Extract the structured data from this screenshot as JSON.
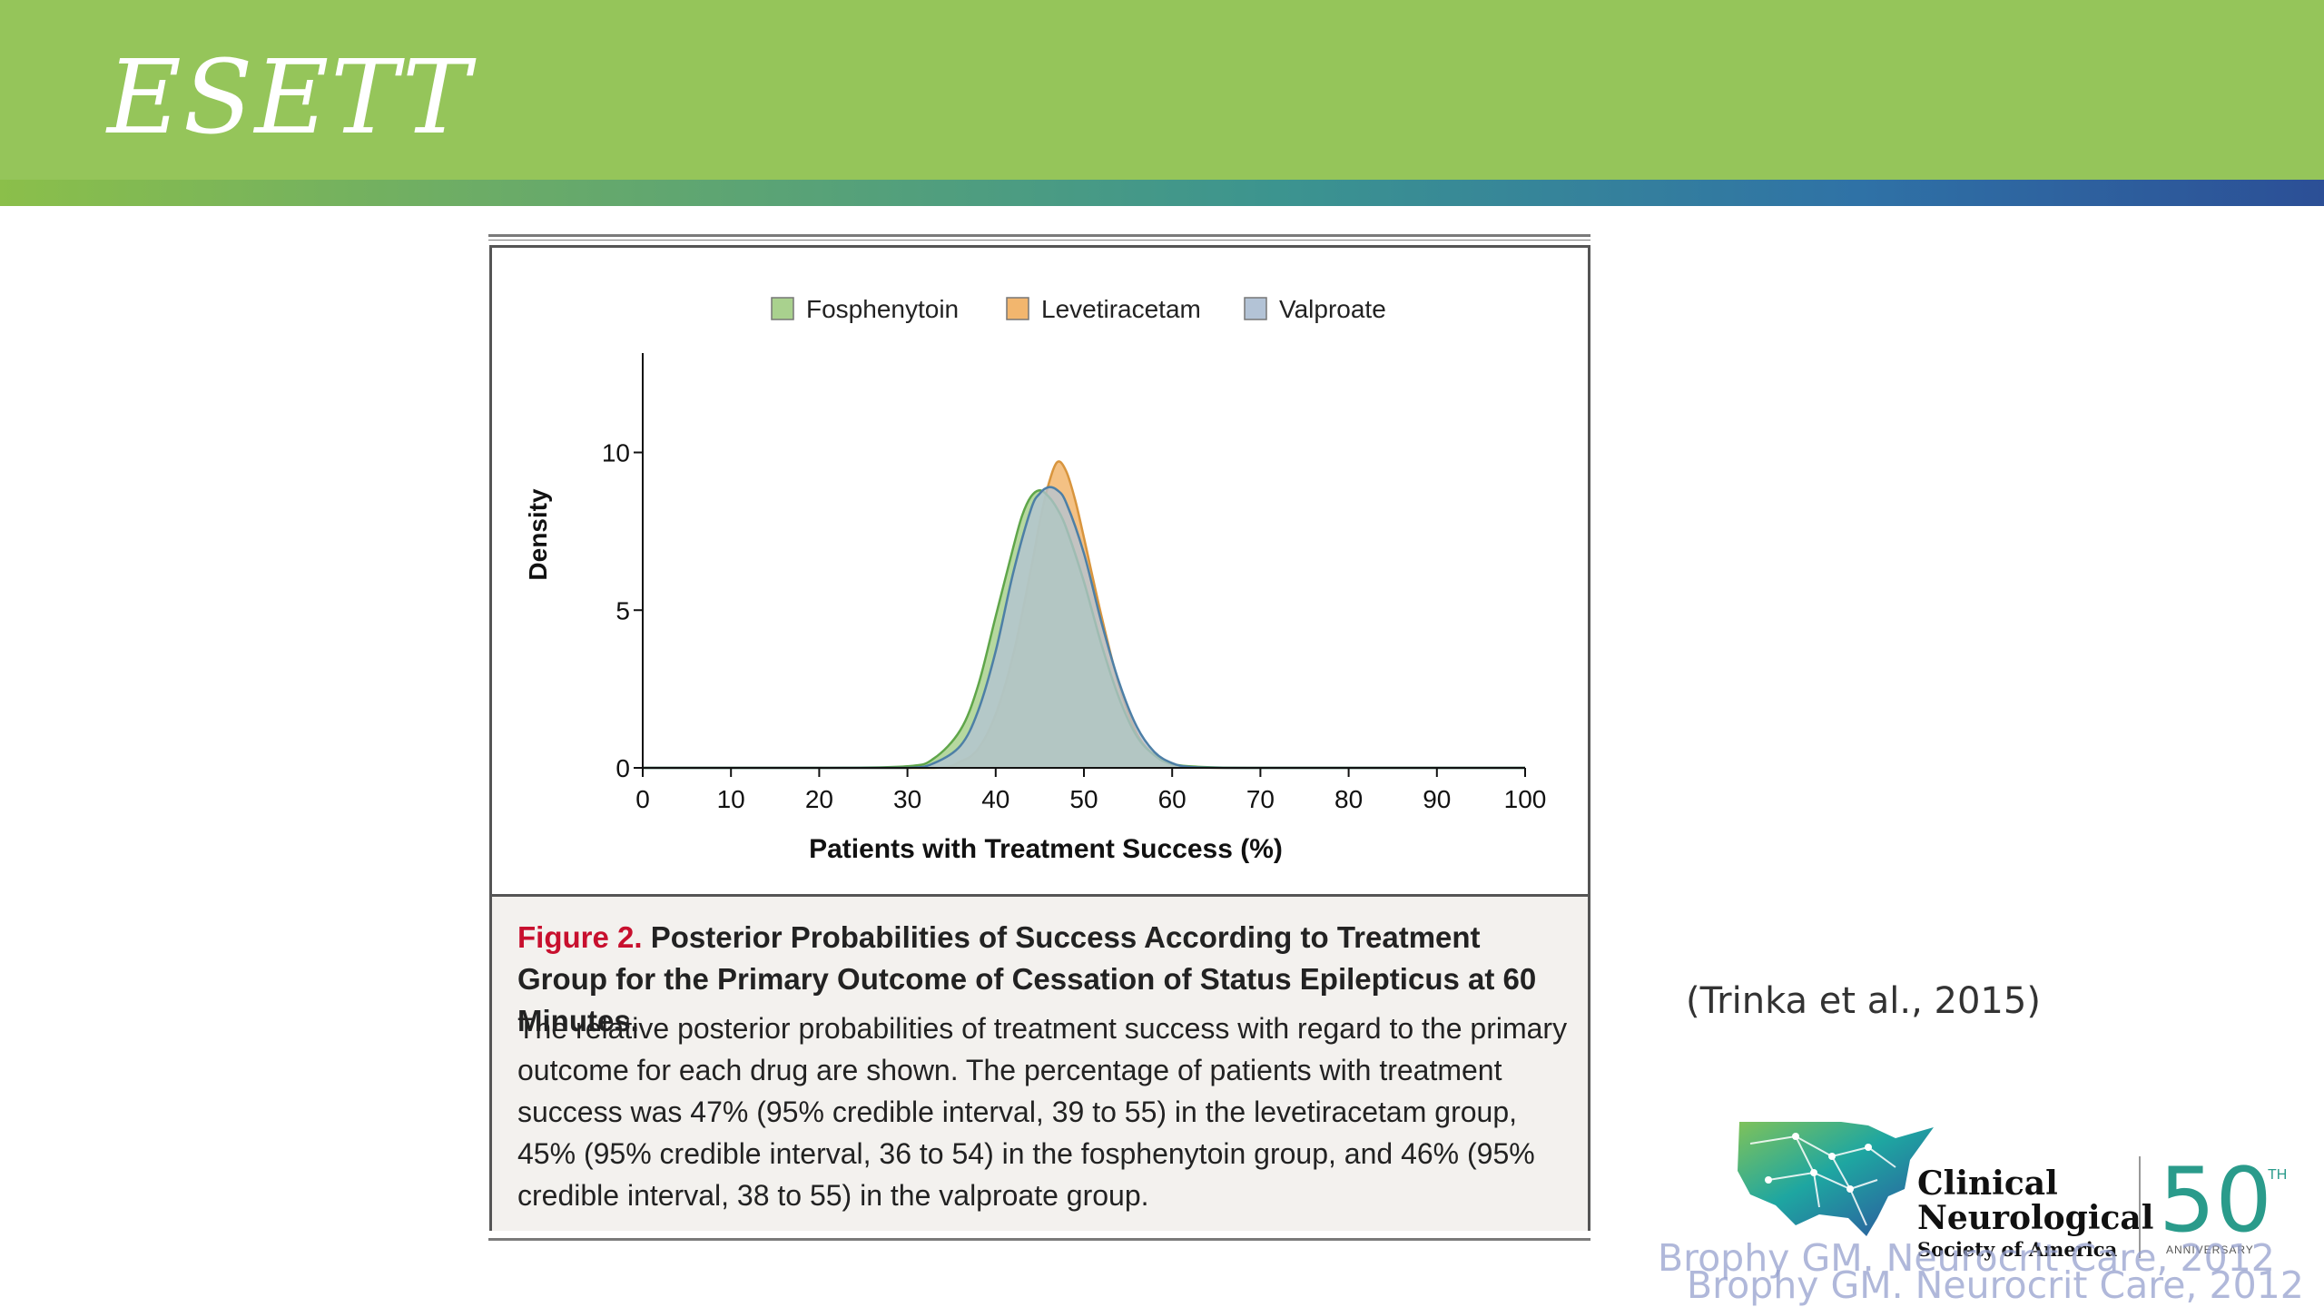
{
  "header": {
    "logo_text": "ESETT",
    "banner_color": "#95c55a"
  },
  "figure": {
    "label": "Figure 2.",
    "title": "Posterior Probabilities of Success According to Treatment Group for the Primary Outcome of Cessation of Status Epilepticus at 60 Minutes.",
    "body": "The relative posterior probabilities of treatment success with regard to the primary outcome for each drug are shown. The percentage of patients with treatment success was 47% (95% credible interval, 39 to 55) in the levetiracetam group, 45% (95% credible interval, 36 to 54) in the fosphenytoin group, and 46% (95% credible interval, 38 to 55) in the valproate group."
  },
  "chart_data": {
    "type": "area",
    "title": "",
    "xlabel": "Patients with Treatment Success (%)",
    "ylabel": "Density",
    "xlim": [
      0,
      100
    ],
    "ylim": [
      0,
      12
    ],
    "xticks": [
      0,
      10,
      20,
      30,
      40,
      50,
      60,
      70,
      80,
      90,
      100
    ],
    "yticks": [
      0,
      5,
      10
    ],
    "legend_position": "top",
    "grid": false,
    "series": [
      {
        "name": "Fosphenytoin",
        "color": "#a9d18e",
        "x": [
          0,
          20,
          30,
          33,
          36,
          38,
          40,
          42,
          43,
          44,
          45,
          46,
          47,
          48,
          50,
          52,
          54,
          56,
          58,
          60,
          64,
          70,
          80,
          100
        ],
        "y": [
          0,
          0,
          0.05,
          0.3,
          1.2,
          2.6,
          4.8,
          7.0,
          8.0,
          8.6,
          8.8,
          8.6,
          8.2,
          7.6,
          5.9,
          3.9,
          2.2,
          1.0,
          0.4,
          0.12,
          0.02,
          0,
          0,
          0
        ]
      },
      {
        "name": "Levetiracetam",
        "color": "#f2b66e",
        "x": [
          0,
          20,
          33,
          36,
          38,
          40,
          42,
          44,
          45,
          46,
          47,
          48,
          49,
          50,
          52,
          54,
          56,
          58,
          60,
          62,
          66,
          70,
          80,
          100
        ],
        "y": [
          0,
          0,
          0,
          0.2,
          0.6,
          1.7,
          3.6,
          6.3,
          7.8,
          9.0,
          9.7,
          9.4,
          8.5,
          7.3,
          4.8,
          2.6,
          1.1,
          0.4,
          0.1,
          0.02,
          0,
          0,
          0,
          0
        ]
      },
      {
        "name": "Valproate",
        "color": "#b3c3d6",
        "x": [
          0,
          20,
          30,
          33,
          36,
          38,
          40,
          42,
          44,
          45,
          46,
          47,
          48,
          50,
          52,
          54,
          56,
          58,
          60,
          62,
          66,
          70,
          80,
          100
        ],
        "y": [
          0,
          0,
          0,
          0.15,
          0.7,
          1.8,
          3.7,
          6.2,
          8.2,
          8.7,
          8.9,
          8.8,
          8.4,
          6.8,
          4.6,
          2.7,
          1.3,
          0.5,
          0.15,
          0.03,
          0,
          0,
          0,
          0
        ]
      }
    ]
  },
  "citation": "(Trinka et al., 2015)",
  "society_logo": {
    "line1": "Clinical",
    "line2": "Neurological",
    "line3": "Society of America",
    "anniversary_number": "50",
    "anniversary_suffix": "TH",
    "anniversary_label": "ANNIVERSARY",
    "map_colors": [
      "#1ea6a1",
      "#3b86c4",
      "#2f4f9e",
      "#7fc25a"
    ]
  },
  "footnote": {
    "text": "Brophy GM. Neurocrit Care, 2012"
  }
}
